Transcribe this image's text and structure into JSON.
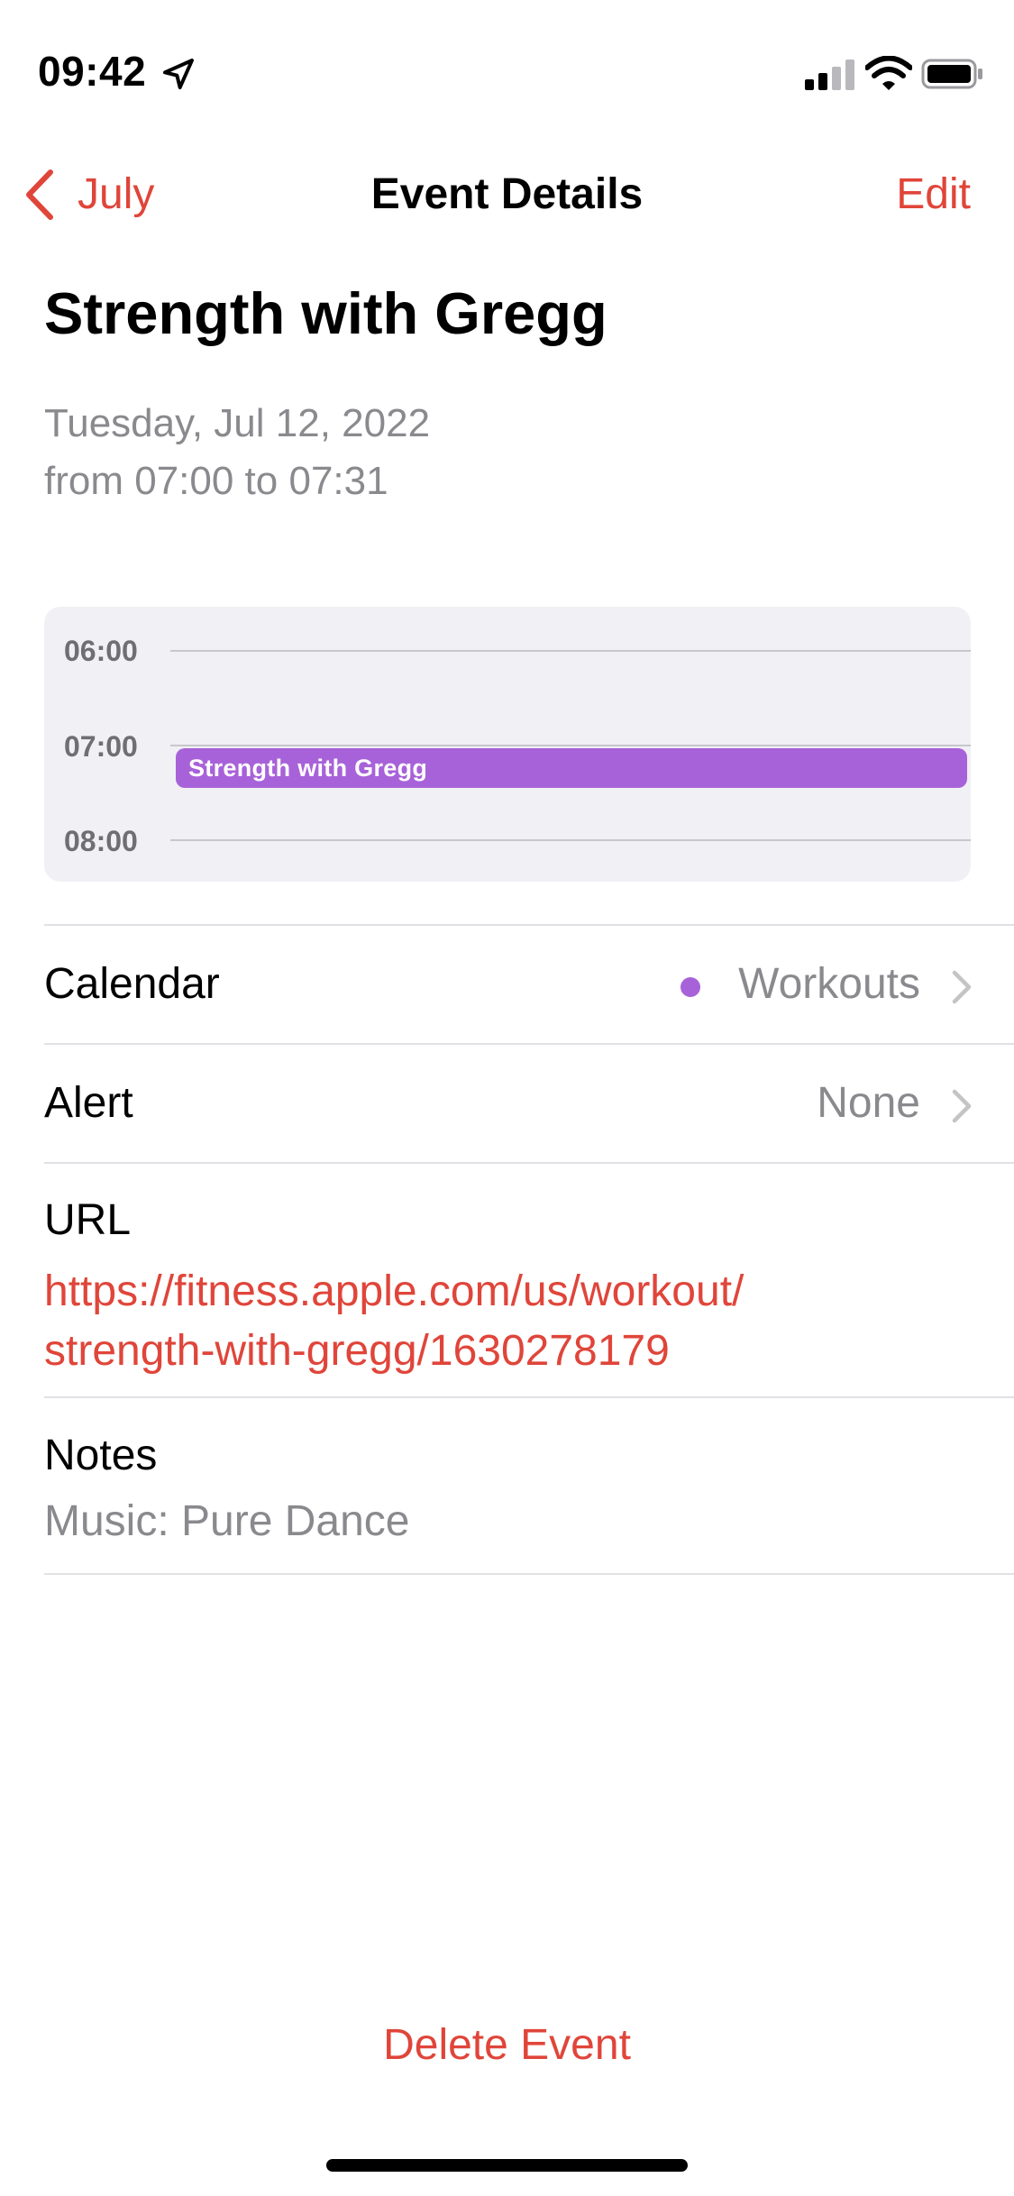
{
  "status_bar": {
    "time": "09:42",
    "icons": [
      "location-arrow-icon",
      "cellular-signal-icon",
      "wifi-icon",
      "battery-icon"
    ]
  },
  "nav": {
    "back_label": "July",
    "title": "Event Details",
    "edit_label": "Edit"
  },
  "event": {
    "title": "Strength with Gregg",
    "date": "Tuesday, Jul 12, 2022",
    "time_range": "from 07:00 to 07:31"
  },
  "timeline": {
    "hours": [
      "06:00",
      "07:00",
      "08:00"
    ],
    "event_label": "Strength with Gregg",
    "event_start": "07:00",
    "event_end": "07:31"
  },
  "details": {
    "calendar_label": "Calendar",
    "calendar_value": "Workouts",
    "alert_label": "Alert",
    "alert_value": "None",
    "url_label": "URL",
    "url_value_line1": "https://fitness.apple.com/us/workout/",
    "url_value_line2": "strength-with-gregg/1630278179",
    "notes_label": "Notes",
    "notes_value": "Music: Pure Dance"
  },
  "actions": {
    "delete_label": "Delete Event"
  },
  "colors": {
    "accent": "#e0453a",
    "calendar": "#a862d9",
    "secondary_text": "#8a8a8e",
    "timeline_bg": "#f1f0f5"
  }
}
